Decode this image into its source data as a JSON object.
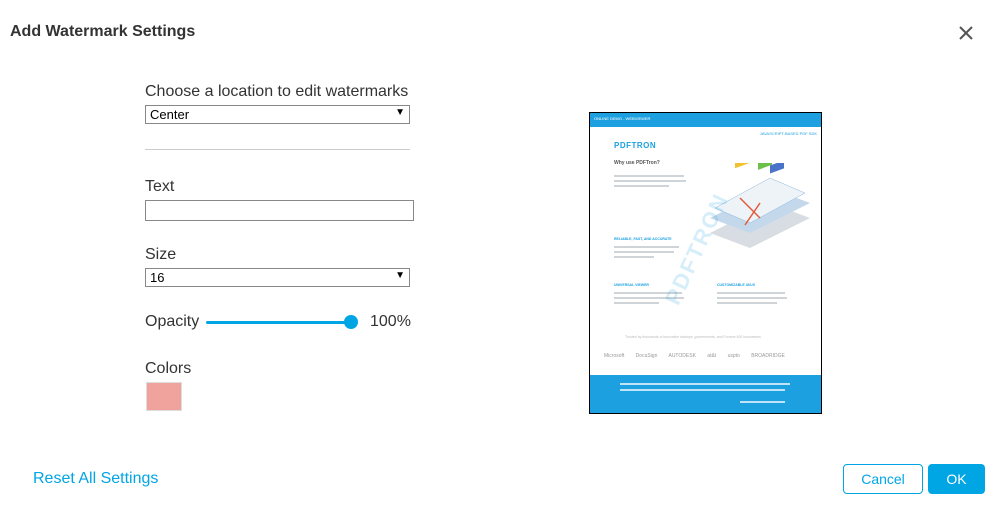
{
  "dialog": {
    "title": "Add Watermark Settings",
    "close_icon": "close-icon"
  },
  "location": {
    "label": "Choose a location to edit watermarks",
    "selected": "Center"
  },
  "text_field": {
    "label": "Text",
    "value": ""
  },
  "size": {
    "label": "Size",
    "selected": "16"
  },
  "opacity": {
    "label": "Opacity",
    "value_text": "100%",
    "fraction": 1.0
  },
  "colors": {
    "label": "Colors",
    "selected_color": "#f0a39d"
  },
  "footer": {
    "reset_label": "Reset All Settings",
    "cancel_label": "Cancel",
    "ok_label": "OK"
  },
  "preview": {
    "header_text": "ONLINE DEMO - WEBVIEWER",
    "subheader_text": "JAVASCRIPT-BASED PDF SDK",
    "logo_text": "PDFTRON",
    "heading": "Why use PDFTron?",
    "section_1": "RELIABLE, FAST, AND ACCURATE",
    "section_2": "UNIVERSAL VIEWER",
    "section_3": "CUSTOMIZABLE UI/UX",
    "trusted_text": "Trusted by thousands of innovative startups, governments, and Fortune 500 businesses",
    "client_logos": [
      "Microsoft",
      "DocuSign",
      "AUTODESK",
      "at&t",
      "uspto",
      "BROADRIDGE"
    ],
    "watermark_text": "PDFTRON"
  },
  "accent_color": "#00a5e4"
}
